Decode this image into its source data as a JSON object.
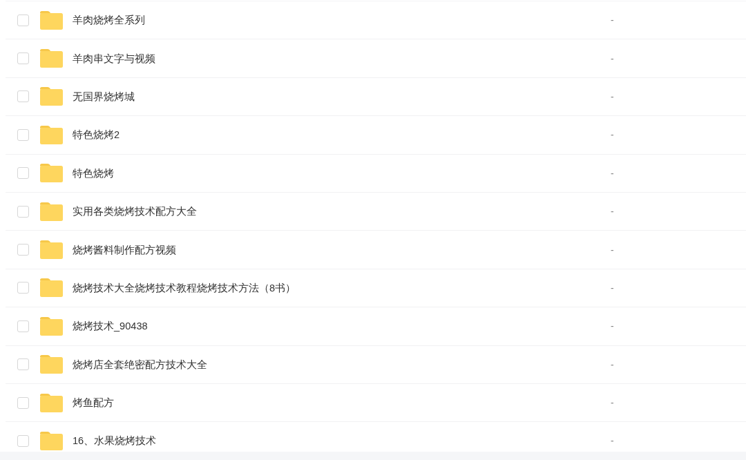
{
  "files": [
    {
      "name": "羊肉烧烤全系列",
      "checked": false,
      "column_2": "-"
    },
    {
      "name": "羊肉串文字与视频",
      "checked": false,
      "column_2": "-"
    },
    {
      "name": "无国界烧烤城",
      "checked": false,
      "column_2": "-"
    },
    {
      "name": "特色烧烤2",
      "checked": false,
      "column_2": "-"
    },
    {
      "name": "特色烧烤",
      "checked": false,
      "column_2": "-"
    },
    {
      "name": "实用各类烧烤技术配方大全",
      "checked": false,
      "column_2": "-"
    },
    {
      "name": "烧烤酱料制作配方视频",
      "checked": false,
      "column_2": "-"
    },
    {
      "name": "烧烤技术大全烧烤技术教程烧烤技术方法（8书）",
      "checked": false,
      "column_2": "-"
    },
    {
      "name": "烧烤技术_90438",
      "checked": false,
      "column_2": "-"
    },
    {
      "name": "烧烤店全套绝密配方技术大全",
      "checked": false,
      "column_2": "-"
    },
    {
      "name": "烤鱼配方",
      "checked": false,
      "column_2": "-"
    },
    {
      "name": "16、水果烧烤技术",
      "checked": false,
      "column_2": "-"
    }
  ]
}
